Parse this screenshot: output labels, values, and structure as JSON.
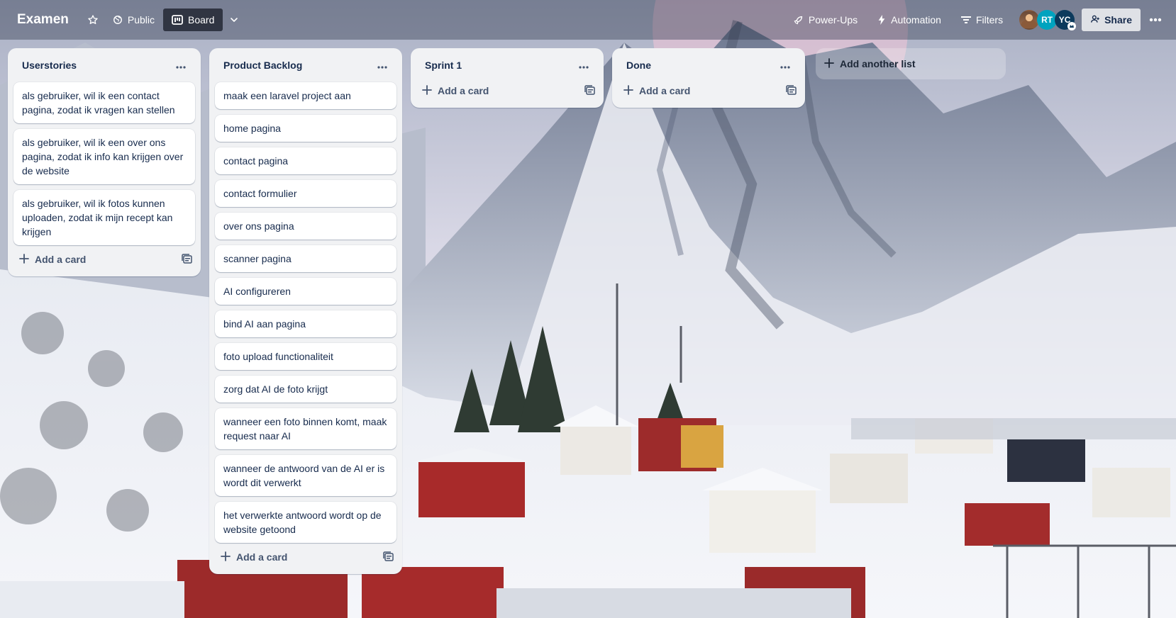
{
  "header": {
    "title": "Examen",
    "visibility_label": "Public",
    "view_label": "Board",
    "powerups_label": "Power-Ups",
    "automation_label": "Automation",
    "filters_label": "Filters",
    "share_label": "Share",
    "members": [
      {
        "initials": "",
        "kind": "photo"
      },
      {
        "initials": "RT",
        "color": "#00a3bf"
      },
      {
        "initials": "YC",
        "color": "#0c3a5c"
      }
    ]
  },
  "lists": [
    {
      "title": "Userstories",
      "cards": [
        "als gebruiker, wil ik een contact pagina, zodat ik vragen kan stellen",
        "als gebruiker, wil ik een over ons pagina, zodat ik info kan krijgen over de website",
        "als gebruiker, wil ik fotos kunnen uploaden, zodat ik mijn recept kan krijgen"
      ],
      "add_label": "Add a card"
    },
    {
      "title": "Product Backlog",
      "cards": [
        "maak een laravel project aan",
        "home pagina",
        "contact pagina",
        "contact formulier",
        "over ons pagina",
        "scanner pagina",
        "AI configureren",
        "bind AI aan pagina",
        "foto upload functionaliteit",
        "zorg dat AI de foto krijgt",
        "wanneer een foto binnen komt, maak request naar AI",
        "wanneer de antwoord van de AI er is wordt dit verwerkt",
        "het verwerkte antwoord wordt op de website getoond"
      ],
      "add_label": "Add a card"
    },
    {
      "title": "Sprint 1",
      "cards": [],
      "add_label": "Add a card"
    },
    {
      "title": "Done",
      "cards": [],
      "add_label": "Add a card"
    }
  ],
  "add_list_label": "Add another list",
  "colors": {
    "list_bg": "#f1f2f4",
    "card_bg": "#ffffff",
    "text": "#172b4d",
    "header_overlay": "rgba(40,48,68,0.38)"
  },
  "icons": {
    "star": "star-icon",
    "public": "globe-icon",
    "board": "board-icon",
    "chevron": "chevron-down-icon",
    "powerups": "rocket-icon",
    "automation": "lightning-icon",
    "filters": "filter-icon",
    "share": "person-add-icon",
    "more": "more-horizontal-icon",
    "plus": "plus-icon",
    "template": "card-template-icon"
  }
}
